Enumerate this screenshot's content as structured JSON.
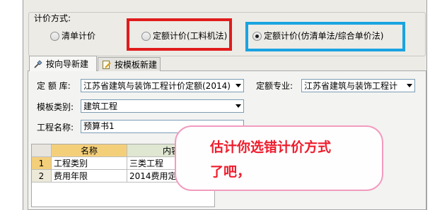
{
  "pricing": {
    "legend": "计价方式:",
    "options": [
      {
        "label": "清单计价",
        "checked": false
      },
      {
        "label": "定额计价(工料机法)",
        "checked": false
      },
      {
        "label": "定额计价(仿清单法/综合单价法)",
        "checked": true
      }
    ]
  },
  "highlight_colors": {
    "red_box": "#e01c1c",
    "blue_box": "#1aa3e0",
    "callout_border": "#f29bbf",
    "callout_text": "#ee1d2d"
  },
  "tabs": [
    {
      "label": "按向导新建",
      "icon": "wizard-icon",
      "active": true
    },
    {
      "label": "按模板新建",
      "icon": "template-icon",
      "active": false
    }
  ],
  "form": {
    "quota_lib_label": "定 额 库:",
    "quota_lib_value": "江苏省建筑与装饰工程计价定额(2014)",
    "quota_major_label": "定额专业:",
    "quota_major_value": "江苏省建筑与装饰工程计",
    "template_type_label": "模板类别:",
    "template_type_value": "建筑工程",
    "project_name_label": "工程名称:",
    "project_name_value": "预算书1"
  },
  "grid": {
    "columns": [
      "名称",
      "内容"
    ],
    "rows": [
      {
        "num": "1",
        "name": "工程类别",
        "content": "三类工程"
      },
      {
        "num": "2",
        "name": "费用年限",
        "content": "2014费用定额"
      }
    ]
  },
  "callout": {
    "line1": "估计你选错计价方式",
    "line2": "了吧，"
  }
}
